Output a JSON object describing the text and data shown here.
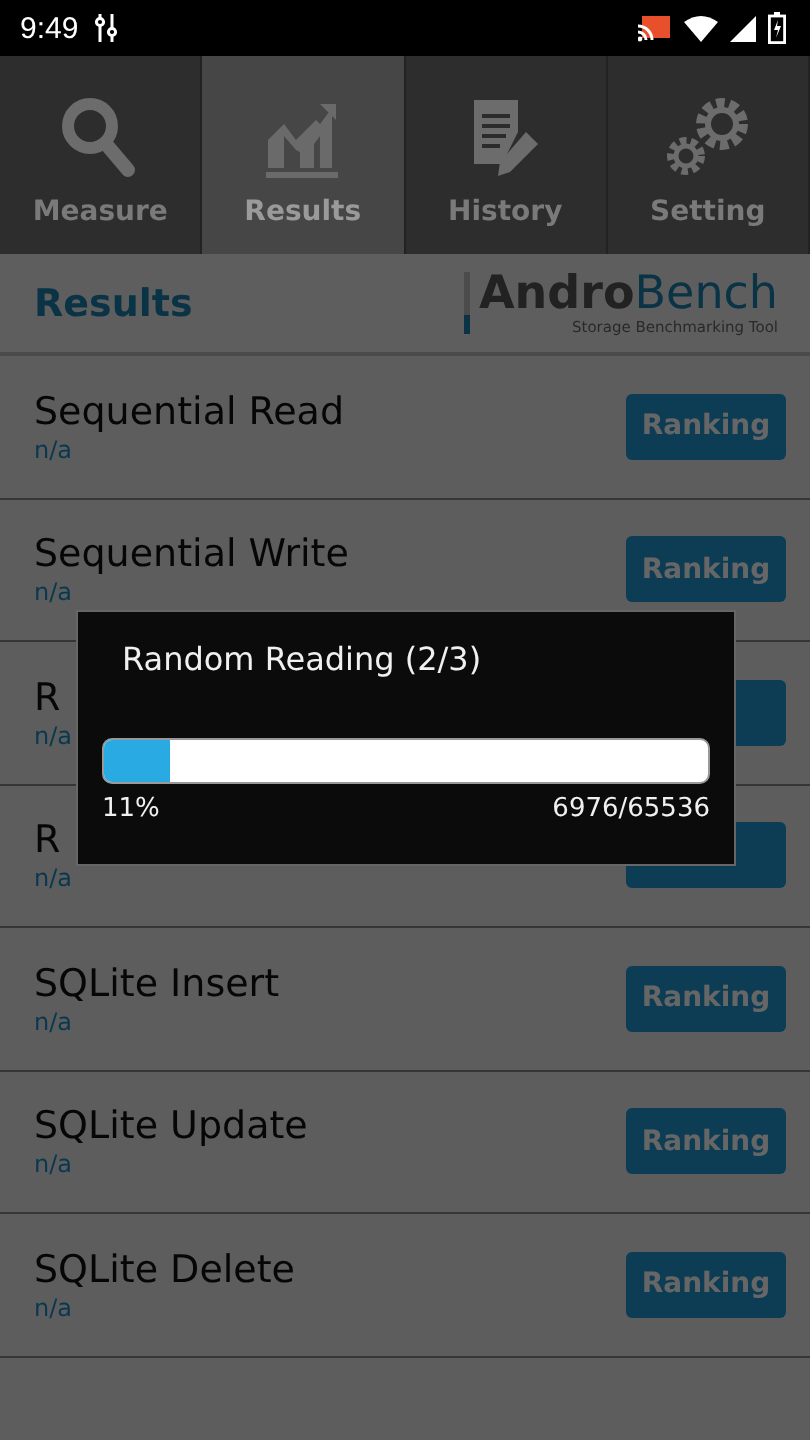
{
  "status_bar": {
    "time": "9:49"
  },
  "tabs": [
    {
      "label": "Measure",
      "selected": false
    },
    {
      "label": "Results",
      "selected": true
    },
    {
      "label": "History",
      "selected": false
    },
    {
      "label": "Setting",
      "selected": false
    }
  ],
  "header": {
    "title": "Results",
    "logo_part_1": "Andro",
    "logo_part_2": "Bench",
    "logo_tagline": "Storage Benchmarking Tool"
  },
  "rows": [
    {
      "name": "Sequential Read",
      "value": "n/a",
      "button": "Ranking"
    },
    {
      "name": "Sequential Write",
      "value": "n/a",
      "button": "Ranking"
    },
    {
      "name": "R",
      "value": "n/a"
    },
    {
      "name": "R",
      "value": "n/a"
    },
    {
      "name": "SQLite Insert",
      "value": "n/a",
      "button": "Ranking"
    },
    {
      "name": "SQLite Update",
      "value": "n/a",
      "button": "Ranking"
    },
    {
      "name": "SQLite Delete",
      "value": "n/a",
      "button": "Ranking"
    }
  ],
  "dialog": {
    "title": "Random Reading (2/3)",
    "level": 0.11,
    "percent": "11%",
    "count": "6976/65536"
  }
}
